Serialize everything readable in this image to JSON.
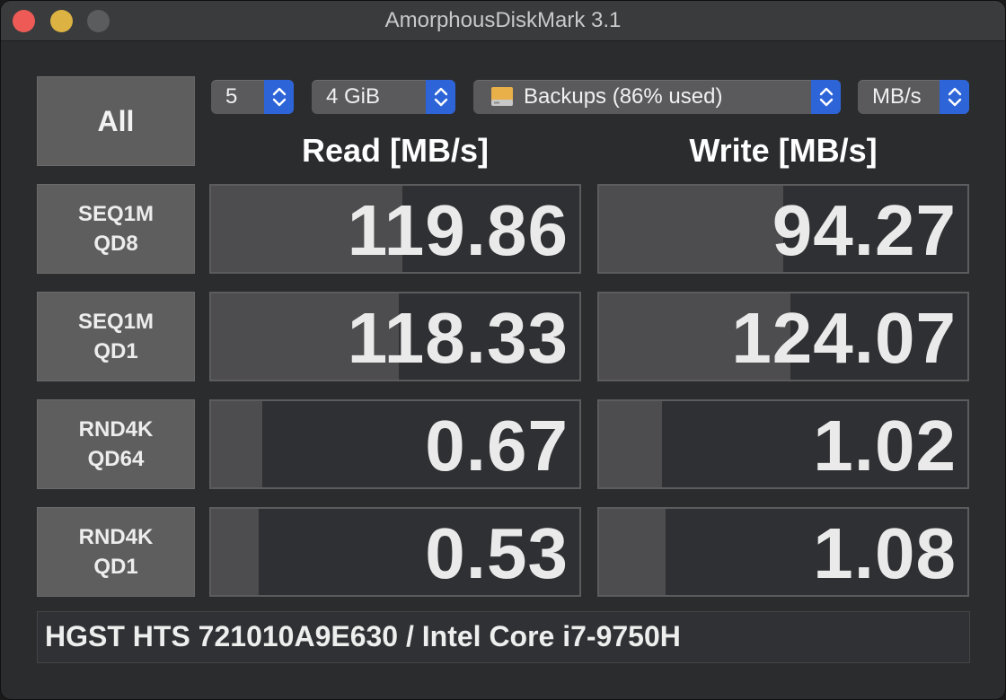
{
  "window": {
    "title": "AmorphousDiskMark 3.1"
  },
  "controls": {
    "all_label": "All",
    "count_value": "5",
    "size_value": "4 GiB",
    "drive_value": "Backups (86% used)",
    "unit_value": "MB/s"
  },
  "headers": {
    "read": "Read [MB/s]",
    "write": "Write [MB/s]"
  },
  "rows": [
    {
      "line1": "SEQ1M",
      "line2": "QD8",
      "read": "119.86",
      "write": "94.27",
      "read_fill_pct": 52,
      "write_fill_pct": 50
    },
    {
      "line1": "SEQ1M",
      "line2": "QD1",
      "read": "118.33",
      "write": "124.07",
      "read_fill_pct": 51,
      "write_fill_pct": 52
    },
    {
      "line1": "RND4K",
      "line2": "QD64",
      "read": "0.67",
      "write": "1.02",
      "read_fill_pct": 14,
      "write_fill_pct": 17
    },
    {
      "line1": "RND4K",
      "line2": "QD1",
      "read": "0.53",
      "write": "1.08",
      "read_fill_pct": 13,
      "write_fill_pct": 18
    }
  ],
  "footer": {
    "text": "HGST HTS 721010A9E630 / Intel Core i7-9750H"
  },
  "colors": {
    "accent": "#2d64d8",
    "close": "#ee5b56",
    "minimize": "#dcb342"
  }
}
